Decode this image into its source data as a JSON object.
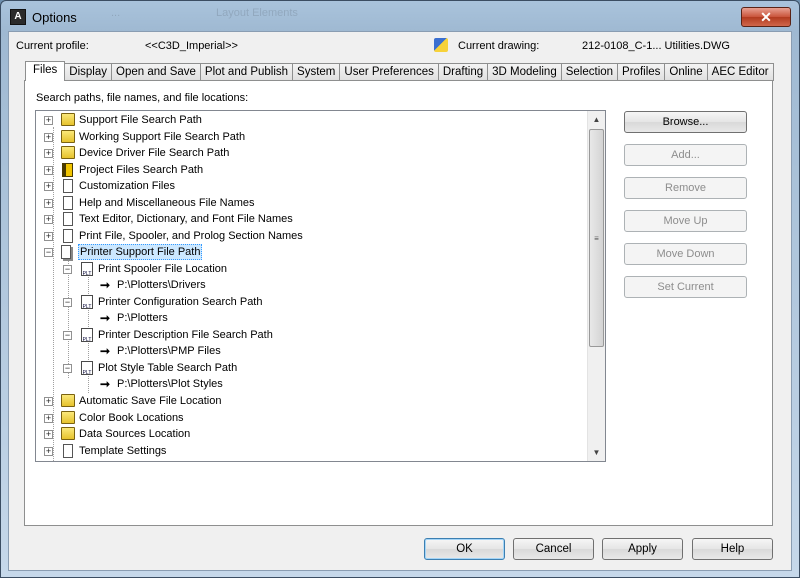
{
  "window": {
    "title": "Options",
    "ghost_title_1": "...",
    "ghost_title_2": "Layout Elements",
    "close_glyph": "✕",
    "app_icon_letter": "A"
  },
  "header": {
    "profile_label": "Current profile:",
    "profile_value": "<<C3D_Imperial>>",
    "drawing_label": "Current drawing:",
    "drawing_value": "212-0108_C-1... Utilities.DWG"
  },
  "tabs": [
    {
      "label": "Files",
      "active": true
    },
    {
      "label": "Display"
    },
    {
      "label": "Open and Save"
    },
    {
      "label": "Plot and Publish"
    },
    {
      "label": "System"
    },
    {
      "label": "User Preferences"
    },
    {
      "label": "Drafting"
    },
    {
      "label": "3D Modeling"
    },
    {
      "label": "Selection"
    },
    {
      "label": "Profiles"
    },
    {
      "label": "Online"
    },
    {
      "label": "AEC Editor"
    }
  ],
  "panel": {
    "caption": "Search paths, file names, and file locations:"
  },
  "tree": [
    {
      "label": "Support File Search Path",
      "icon": "folder-icon",
      "expander": "+"
    },
    {
      "label": "Working Support File Search Path",
      "icon": "folder-icon",
      "expander": "+"
    },
    {
      "label": "Device Driver File Search Path",
      "icon": "folder-icon",
      "expander": "+"
    },
    {
      "label": "Project Files Search Path",
      "icon": "book-icon",
      "expander": "+"
    },
    {
      "label": "Customization Files",
      "icon": "document-icon",
      "expander": "+"
    },
    {
      "label": "Help and Miscellaneous File Names",
      "icon": "document-icon",
      "expander": "+"
    },
    {
      "label": "Text Editor, Dictionary, and Font File Names",
      "icon": "document-icon",
      "expander": "+"
    },
    {
      "label": "Print File, Spooler, and Prolog Section Names",
      "icon": "document-icon",
      "expander": "+"
    },
    {
      "label": "Printer Support File Path",
      "icon": "documents-icon",
      "expander": "−",
      "selected": true
    },
    {
      "label": "Print Spooler File Location",
      "icon": "plot-file-icon",
      "expander": "−"
    },
    {
      "label": "P:\\Plotters\\Drivers",
      "icon": "arrow-icon"
    },
    {
      "label": "Printer Configuration Search Path",
      "icon": "plot-file-icon",
      "expander": "−"
    },
    {
      "label": "P:\\Plotters",
      "icon": "arrow-icon"
    },
    {
      "label": "Printer Description File Search Path",
      "icon": "plot-file-icon",
      "expander": "−"
    },
    {
      "label": "P:\\Plotters\\PMP Files",
      "icon": "arrow-icon"
    },
    {
      "label": "Plot Style Table Search Path",
      "icon": "plot-file-icon",
      "expander": "−"
    },
    {
      "label": "P:\\Plotters\\Plot Styles",
      "icon": "arrow-icon"
    },
    {
      "label": "Automatic Save File Location",
      "icon": "folder-icon",
      "expander": "+"
    },
    {
      "label": "Color Book Locations",
      "icon": "folder-icon",
      "expander": "+"
    },
    {
      "label": "Data Sources Location",
      "icon": "folder-icon",
      "expander": "+"
    },
    {
      "label": "Template Settings",
      "icon": "document-icon",
      "expander": "+"
    }
  ],
  "side_buttons": {
    "browse": "Browse...",
    "add": "Add...",
    "remove": "Remove",
    "move_up": "Move Up",
    "move_down": "Move Down",
    "set_current": "Set Current"
  },
  "bottom_buttons": {
    "ok": "OK",
    "cancel": "Cancel",
    "apply": "Apply",
    "help": "Help"
  },
  "colors": {
    "selection_bg": "#cce8ff",
    "close_button": "#c9533a"
  }
}
